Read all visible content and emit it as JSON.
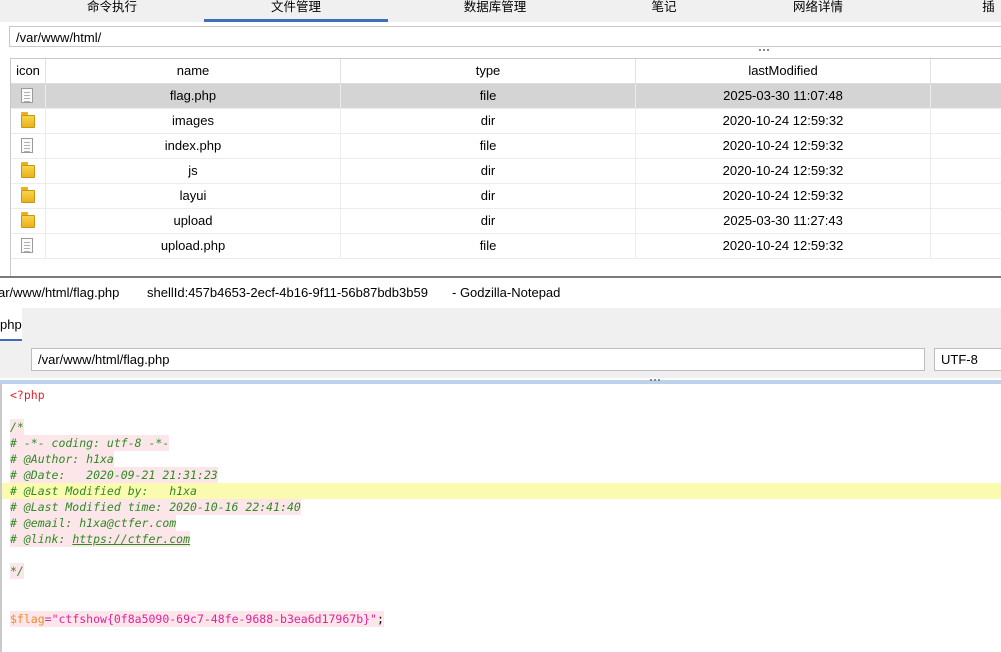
{
  "top_tabs": [
    "命令执行",
    "文件管理",
    "数据库管理",
    "笔记",
    "网络详情",
    "插"
  ],
  "active_tab": "文件管理",
  "current_path": "/var/www/html/",
  "table": {
    "headers": [
      "icon",
      "name",
      "type",
      "lastModified"
    ],
    "rows": [
      {
        "icon": "file-icon",
        "name": "flag.php",
        "type": "file",
        "lastModified": "2025-03-30 11:07:48",
        "selected": true
      },
      {
        "icon": "folder-icon",
        "name": "images",
        "type": "dir",
        "lastModified": "2020-10-24 12:59:32"
      },
      {
        "icon": "file-icon",
        "name": "index.php",
        "type": "file",
        "lastModified": "2020-10-24 12:59:32"
      },
      {
        "icon": "folder-icon",
        "name": "js",
        "type": "dir",
        "lastModified": "2020-10-24 12:59:32"
      },
      {
        "icon": "folder-icon",
        "name": "layui",
        "type": "dir",
        "lastModified": "2020-10-24 12:59:32"
      },
      {
        "icon": "folder-icon",
        "name": "upload",
        "type": "dir",
        "lastModified": "2025-03-30 11:27:43"
      },
      {
        "icon": "file-icon",
        "name": "upload.php",
        "type": "file",
        "lastModified": "2020-10-24 12:59:32"
      }
    ]
  },
  "notepad": {
    "title_path": "ar/www/html/flag.php",
    "shell_id": "shellId:457b4653-2ecf-4b16-9f11-56b87bdb3b59",
    "app_name": "- Godzilla-Notepad",
    "tab_label": "php",
    "file_path": "/var/www/html/flag.php",
    "encoding": "UTF-8"
  },
  "code": {
    "open_tag": "<?php",
    "c_open": "/*",
    "c1": "# -*- coding: utf-8 -*-",
    "c2": "# @Author: h1xa",
    "c3": "# @Date:   2020-09-21 21:31:23",
    "c4": "# @Last Modified by:   h1xa",
    "c5": "# @Last Modified time: 2020-10-16 22:41:40",
    "c6": "# @email: h1xa@ctfer.com",
    "c7_prefix": "# @link: ",
    "c7_link": "https://ctfer.com",
    "c_close": "*/",
    "flag_var": "$flag",
    "flag_eq": "=",
    "flag_str": "\"ctfshow{0f8a5090-69c7-48fe-9688-b3ea6d17967b}\"",
    "flag_end": ";"
  },
  "colors": {
    "accent": "#3c6fb5",
    "selected_row": "#d4d4d4",
    "current_line": "#fbfbb0",
    "comment": "#2e8b22",
    "string": "#e0229a",
    "variable": "#f08c2c",
    "php_tag": "#e8202a"
  }
}
